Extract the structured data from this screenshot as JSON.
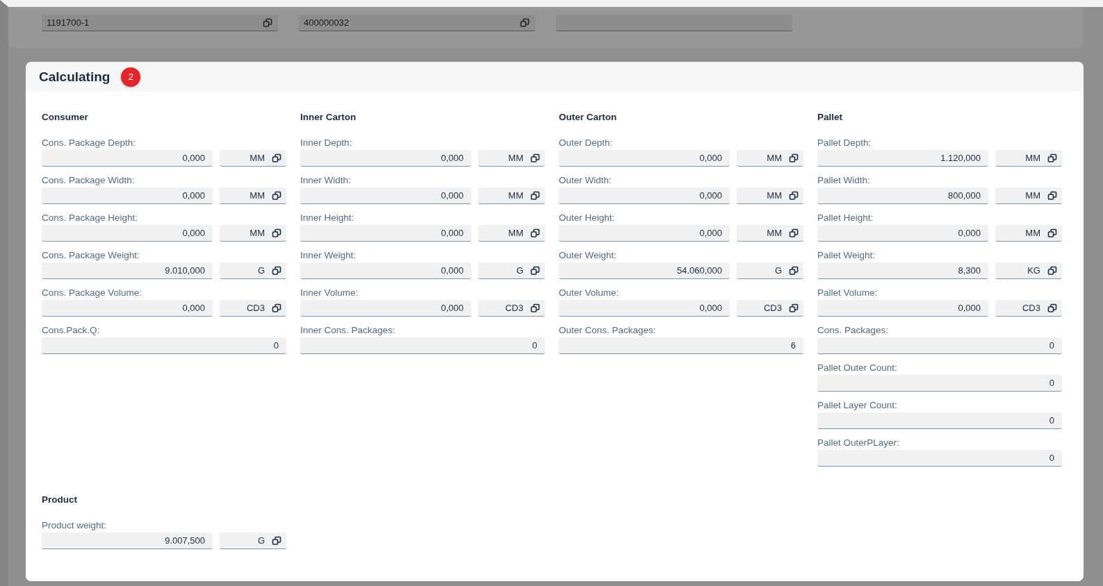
{
  "top_fields": [
    {
      "kind": "copyable",
      "value": "1191700-1"
    },
    {
      "kind": "copyable",
      "value": "400000032"
    },
    {
      "kind": "empty"
    }
  ],
  "card": {
    "title": "Calculating",
    "badge": "2",
    "sections": [
      {
        "title": "Consumer",
        "fields": [
          {
            "kind": "measure",
            "label": "Cons. Package Depth:",
            "value": "0,000",
            "unit": "MM"
          },
          {
            "kind": "measure",
            "label": "Cons. Package Width:",
            "value": "0,000",
            "unit": "MM"
          },
          {
            "kind": "measure",
            "label": "Cons. Package Height:",
            "value": "0,000",
            "unit": "MM"
          },
          {
            "kind": "measure",
            "label": "Cons. Package Weight:",
            "value": "9.010,000",
            "unit": "G"
          },
          {
            "kind": "measure",
            "label": "Cons. Package Volume:",
            "value": "0,000",
            "unit": "CD3"
          },
          {
            "kind": "count",
            "label": "Cons.Pack.Q:",
            "value": "0"
          }
        ]
      },
      {
        "title": "Inner Carton",
        "fields": [
          {
            "kind": "measure",
            "label": "Inner Depth:",
            "value": "0,000",
            "unit": "MM"
          },
          {
            "kind": "measure",
            "label": "Inner Width:",
            "value": "0,000",
            "unit": "MM"
          },
          {
            "kind": "measure",
            "label": "Inner Height:",
            "value": "0,000",
            "unit": "MM"
          },
          {
            "kind": "measure",
            "label": "Inner Weight:",
            "value": "0,000",
            "unit": "G"
          },
          {
            "kind": "measure",
            "label": "Inner Volume:",
            "value": "0,000",
            "unit": "CD3"
          },
          {
            "kind": "count",
            "label": "Inner Cons. Packages:",
            "value": "0"
          }
        ]
      },
      {
        "title": "Outer Carton",
        "fields": [
          {
            "kind": "measure",
            "label": "Outer Depth:",
            "value": "0,000",
            "unit": "MM"
          },
          {
            "kind": "measure",
            "label": "Outer Width:",
            "value": "0,000",
            "unit": "MM"
          },
          {
            "kind": "measure",
            "label": "Outer Height:",
            "value": "0,000",
            "unit": "MM"
          },
          {
            "kind": "measure",
            "label": "Outer Weight:",
            "value": "54.060,000",
            "unit": "G"
          },
          {
            "kind": "measure",
            "label": "Outer Volume:",
            "value": "0,000",
            "unit": "CD3"
          },
          {
            "kind": "count",
            "label": "Outer Cons. Packages:",
            "value": "6"
          }
        ]
      },
      {
        "title": "Pallet",
        "fields": [
          {
            "kind": "measure",
            "label": "Pallet Depth:",
            "value": "1.120,000",
            "unit": "MM"
          },
          {
            "kind": "measure",
            "label": "Pallet Width:",
            "value": "800,000",
            "unit": "MM"
          },
          {
            "kind": "measure",
            "label": "Pallet Height:",
            "value": "0,000",
            "unit": "MM"
          },
          {
            "kind": "measure",
            "label": "Pallet Weight:",
            "value": "8,300",
            "unit": "KG"
          },
          {
            "kind": "measure",
            "label": "Pallet Volume:",
            "value": "0,000",
            "unit": "CD3"
          },
          {
            "kind": "count",
            "label": "Cons. Packages:",
            "value": "0"
          },
          {
            "kind": "count",
            "label": "Pallet Outer Count:",
            "value": "0"
          },
          {
            "kind": "count",
            "label": "Pallet Layer Count:",
            "value": "0"
          },
          {
            "kind": "count",
            "label": "Pallet OuterPLayer:",
            "value": "0"
          }
        ]
      },
      {
        "title": "Product",
        "fields": [
          {
            "kind": "measure",
            "label": "Product weight:",
            "value": "9.007,500",
            "unit": "G"
          }
        ]
      }
    ]
  }
}
